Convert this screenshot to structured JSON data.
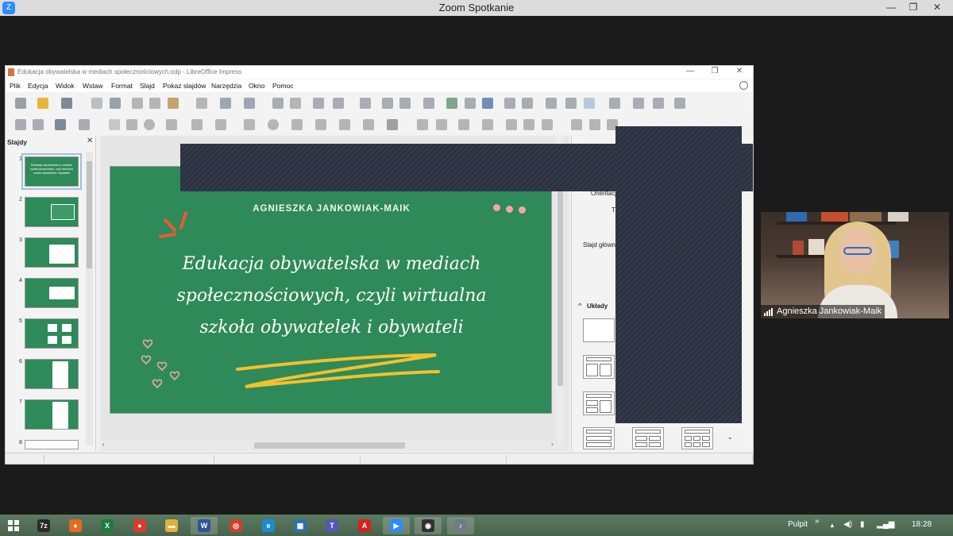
{
  "zoom": {
    "title": "Zoom Spotkanie",
    "logo": "Z",
    "controls": {
      "minimize": "—",
      "restore": "❐",
      "close": "✕"
    }
  },
  "libreoffice": {
    "window_title": "Edukacja obywatelska w mediach społecznościowych.odp - LibreOffice Impress",
    "controls": {
      "minimize": "—",
      "restore": "❐",
      "close": "✕"
    },
    "menu": [
      "Plik",
      "Edycja",
      "Widok",
      "Wstaw",
      "Format",
      "Slajd",
      "Pokaz slajdów",
      "Narzędzia",
      "Okno",
      "Pomoc"
    ],
    "slides_pane": {
      "title": "Slajdy",
      "close": "✕",
      "thumbnails": [
        {
          "num": "1",
          "text": "Edukacja obywatelska w mediach społecznościowych, czyli wirtualna szkoła obywatelek i obywateli"
        },
        {
          "num": "2",
          "text": ""
        },
        {
          "num": "3",
          "text": ""
        },
        {
          "num": "4",
          "text": ""
        },
        {
          "num": "5",
          "text": ""
        },
        {
          "num": "6",
          "text": ""
        },
        {
          "num": "7",
          "text": ""
        },
        {
          "num": "8",
          "text": ""
        }
      ]
    },
    "slide": {
      "author": "AGNIESZKA JANKOWIAK-MAIK",
      "headline_lines": [
        "Edukacja obywatelska w mediach",
        "społecznościowych, czyli wirtualna",
        "szkoła obywatelek i obywateli"
      ]
    },
    "sidebar": {
      "orientation_label": "Orientacj",
      "t_label": "T",
      "master_label": "Slajd główn",
      "layouts_label": "Układy",
      "layouts_chevron": "^"
    },
    "scroll_arrows": {
      "left": "‹",
      "right": "›",
      "down": "⌄"
    }
  },
  "participant": {
    "name": "Agnieszka Jankowiak-Maik"
  },
  "taskbar": {
    "desktop_label": "Pulpit",
    "desktop_chevron": "»",
    "time": "18:28",
    "apps": [
      {
        "name": "7z",
        "glyph": "7z",
        "color": "#2a2a2a"
      },
      {
        "name": "firefox",
        "glyph": "●",
        "color": "#e66a1f"
      },
      {
        "name": "excel",
        "glyph": "X",
        "color": "#1f7a43"
      },
      {
        "name": "chrome",
        "glyph": "●",
        "color": "#d93b2f"
      },
      {
        "name": "explorer",
        "glyph": "▬",
        "color": "#e0b23a"
      },
      {
        "name": "word",
        "glyph": "W",
        "color": "#2b579a"
      },
      {
        "name": "app-red",
        "glyph": "◎",
        "color": "#c9422d"
      },
      {
        "name": "edge",
        "glyph": "e",
        "color": "#1a8ad3"
      },
      {
        "name": "network",
        "glyph": "▦",
        "color": "#2f6fb2"
      },
      {
        "name": "teams",
        "glyph": "T",
        "color": "#5558af"
      },
      {
        "name": "acrobat",
        "glyph": "A",
        "color": "#d4221d"
      },
      {
        "name": "zoom",
        "glyph": "▶",
        "color": "#2d8cff"
      },
      {
        "name": "obs",
        "glyph": "◉",
        "color": "#303030"
      },
      {
        "name": "mic",
        "glyph": "♪",
        "color": "#707b86"
      }
    ]
  }
}
